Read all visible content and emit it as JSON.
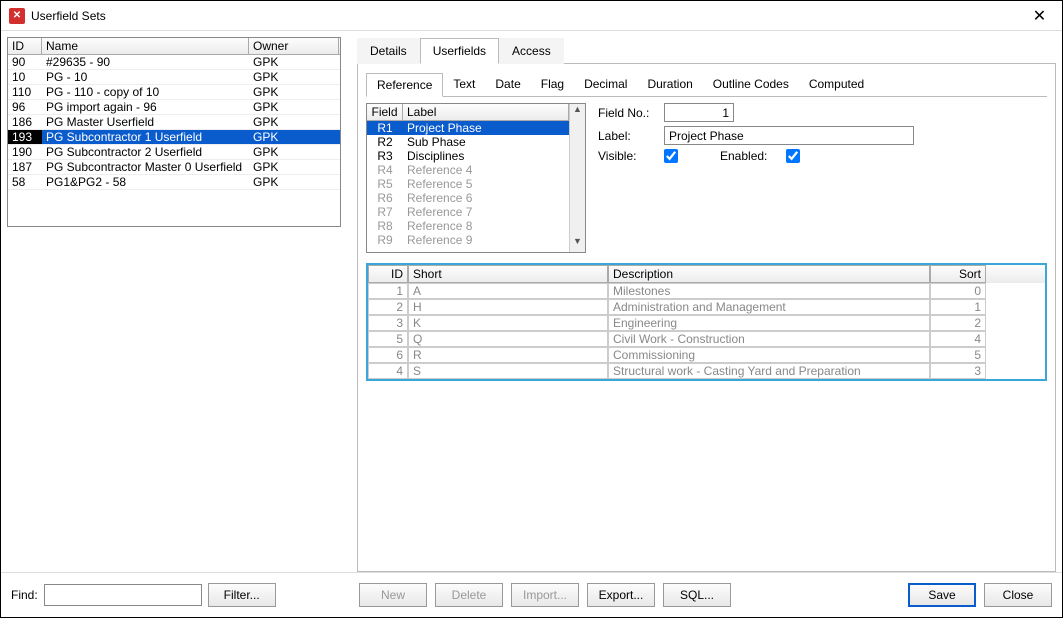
{
  "window": {
    "title": "Userfield Sets"
  },
  "left": {
    "headers": {
      "id": "ID",
      "name": "Name",
      "owner": "Owner"
    },
    "rows": [
      {
        "id": "90",
        "name": "#29635 - 90",
        "owner": "GPK"
      },
      {
        "id": "10",
        "name": "PG - 10",
        "owner": "GPK"
      },
      {
        "id": "110",
        "name": "PG - 110 - copy of 10",
        "owner": "GPK"
      },
      {
        "id": "96",
        "name": "PG import again - 96",
        "owner": "GPK"
      },
      {
        "id": "186",
        "name": "PG Master Userfield",
        "owner": "GPK"
      },
      {
        "id": "193",
        "name": "PG Subcontractor 1 Userfield",
        "owner": "GPK",
        "selected": true
      },
      {
        "id": "190",
        "name": "PG Subcontractor 2 Userfield",
        "owner": "GPK"
      },
      {
        "id": "187",
        "name": "PG Subcontractor Master 0 Userfield",
        "owner": "GPK"
      },
      {
        "id": "58",
        "name": "PG1&PG2 - 58",
        "owner": "GPK"
      }
    ]
  },
  "tabs": {
    "details": "Details",
    "userfields": "Userfields",
    "access": "Access"
  },
  "subtabs": {
    "reference": "Reference",
    "text": "Text",
    "date": "Date",
    "flag": "Flag",
    "decimal": "Decimal",
    "duration": "Duration",
    "outline": "Outline Codes",
    "computed": "Computed"
  },
  "fieldList": {
    "headers": {
      "field": "Field",
      "label": "Label"
    },
    "rows": [
      {
        "field": "R1",
        "label": "Project Phase",
        "selected": true
      },
      {
        "field": "R2",
        "label": "Sub Phase"
      },
      {
        "field": "R3",
        "label": "Disciplines"
      },
      {
        "field": "R4",
        "label": "Reference 4",
        "disabled": true
      },
      {
        "field": "R5",
        "label": "Reference 5",
        "disabled": true
      },
      {
        "field": "R6",
        "label": "Reference 6",
        "disabled": true
      },
      {
        "field": "R7",
        "label": "Reference 7",
        "disabled": true
      },
      {
        "field": "R8",
        "label": "Reference 8",
        "disabled": true
      },
      {
        "field": "R9",
        "label": "Reference 9",
        "disabled": true
      }
    ]
  },
  "props": {
    "fieldNoLabel": "Field No.:",
    "fieldNoValue": "1",
    "labelLabel": "Label:",
    "labelValue": "Project Phase",
    "visibleLabel": "Visible:",
    "enabledLabel": "Enabled:"
  },
  "values": {
    "headers": {
      "id": "ID",
      "short": "Short",
      "desc": "Description",
      "sort": "Sort"
    },
    "rows": [
      {
        "id": "1",
        "short": "A",
        "desc": "Milestones",
        "sort": "0"
      },
      {
        "id": "2",
        "short": "H",
        "desc": "Administration and Management",
        "sort": "1"
      },
      {
        "id": "3",
        "short": "K",
        "desc": "Engineering",
        "sort": "2"
      },
      {
        "id": "5",
        "short": "Q",
        "desc": "Civil Work - Construction",
        "sort": "4"
      },
      {
        "id": "6",
        "short": "R",
        "desc": "Commissioning",
        "sort": "5"
      },
      {
        "id": "4",
        "short": "S",
        "desc": "Structural work - Casting Yard and Preparation",
        "sort": "3"
      }
    ]
  },
  "footer": {
    "findLabel": "Find:",
    "filter": "Filter...",
    "new": "New",
    "delete": "Delete",
    "import": "Import...",
    "export": "Export...",
    "sql": "SQL...",
    "save": "Save",
    "close": "Close"
  }
}
